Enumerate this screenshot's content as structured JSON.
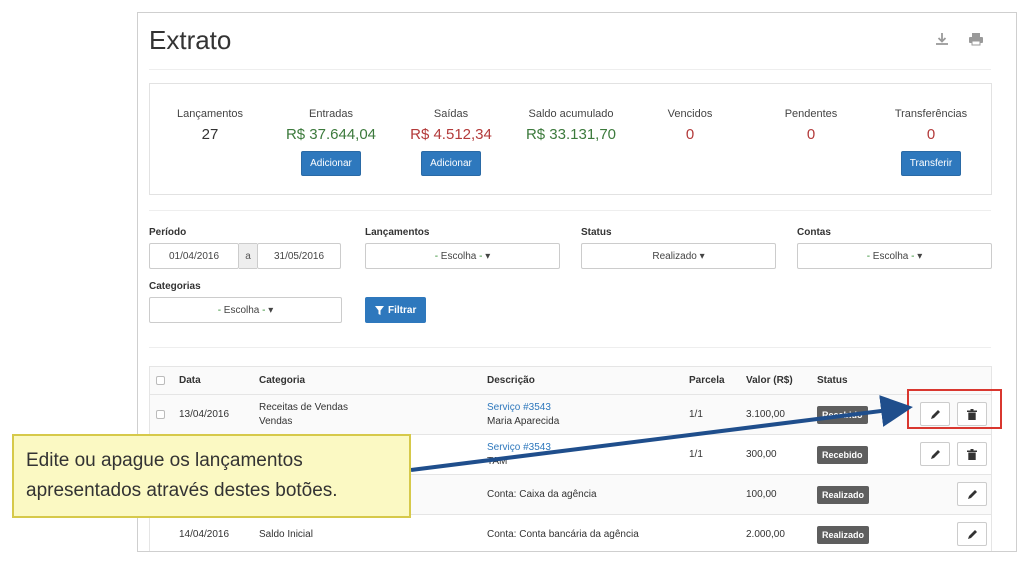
{
  "page": {
    "title": "Extrato"
  },
  "icons": {
    "download": "download-icon",
    "print": "printer-icon"
  },
  "summary": {
    "lancamentos": {
      "label": "Lançamentos",
      "value": "27"
    },
    "entradas": {
      "label": "Entradas",
      "value": "R$ 37.644,04",
      "button": "Adicionar"
    },
    "saidas": {
      "label": "Saídas",
      "value": "R$ 4.512,34",
      "button": "Adicionar"
    },
    "saldo": {
      "label": "Saldo acumulado",
      "value": "R$ 33.131,70"
    },
    "vencidos": {
      "label": "Vencidos",
      "value": "0"
    },
    "pendentes": {
      "label": "Pendentes",
      "value": "0"
    },
    "transferencias": {
      "label": "Transferências",
      "value": "0",
      "button": "Transferir"
    }
  },
  "filters": {
    "periodo": {
      "label": "Período",
      "from": "01/04/2016",
      "sep": "a",
      "to": "31/05/2016"
    },
    "lancamentos": {
      "label": "Lançamentos",
      "value": "Escolha"
    },
    "status": {
      "label": "Status",
      "value": "Realizado"
    },
    "contas": {
      "label": "Contas",
      "value": "Escolha"
    },
    "categorias": {
      "label": "Categorias",
      "value": "Escolha"
    },
    "filter_button": "Filtrar"
  },
  "table": {
    "headers": {
      "data": "Data",
      "categoria": "Categoria",
      "descricao": "Descrição",
      "parcela": "Parcela",
      "valor": "Valor (R$)",
      "status": "Status"
    },
    "rows": [
      {
        "data": "13/04/2016",
        "categoria": "Receitas de Vendas",
        "categoria2": "Vendas",
        "descricao": "Serviço #3543",
        "descricao2": "Maria Aparecida",
        "parcela": "1/1",
        "valor": "3.100,00",
        "status": "Recebido"
      },
      {
        "data": "",
        "categoria": "",
        "categoria2": "",
        "descricao": "Serviço #3543",
        "descricao2": "TAM",
        "parcela": "1/1",
        "valor": "300,00",
        "status": "Recebido"
      },
      {
        "data": "",
        "categoria": "",
        "categoria2": "",
        "descricao": "Conta: Caixa da agência",
        "descricao2": "",
        "parcela": "",
        "valor": "100,00",
        "status": "Realizado"
      },
      {
        "data": "14/04/2016",
        "categoria": "Saldo Inicial",
        "categoria2": "",
        "descricao": "Conta: Conta bancária da agência",
        "descricao2": "",
        "parcela": "",
        "valor": "2.000,00",
        "status": "Realizado"
      }
    ]
  },
  "callout": {
    "line1": "Edite ou apague os lançamentos",
    "line2": "apresentados através destes botões."
  },
  "colors": {
    "accent": "#2e78bd",
    "positive": "#3c7a3c",
    "negative": "#b33a3a",
    "highlight": "#d9372f",
    "callout_bg": "#fbf9c3"
  }
}
